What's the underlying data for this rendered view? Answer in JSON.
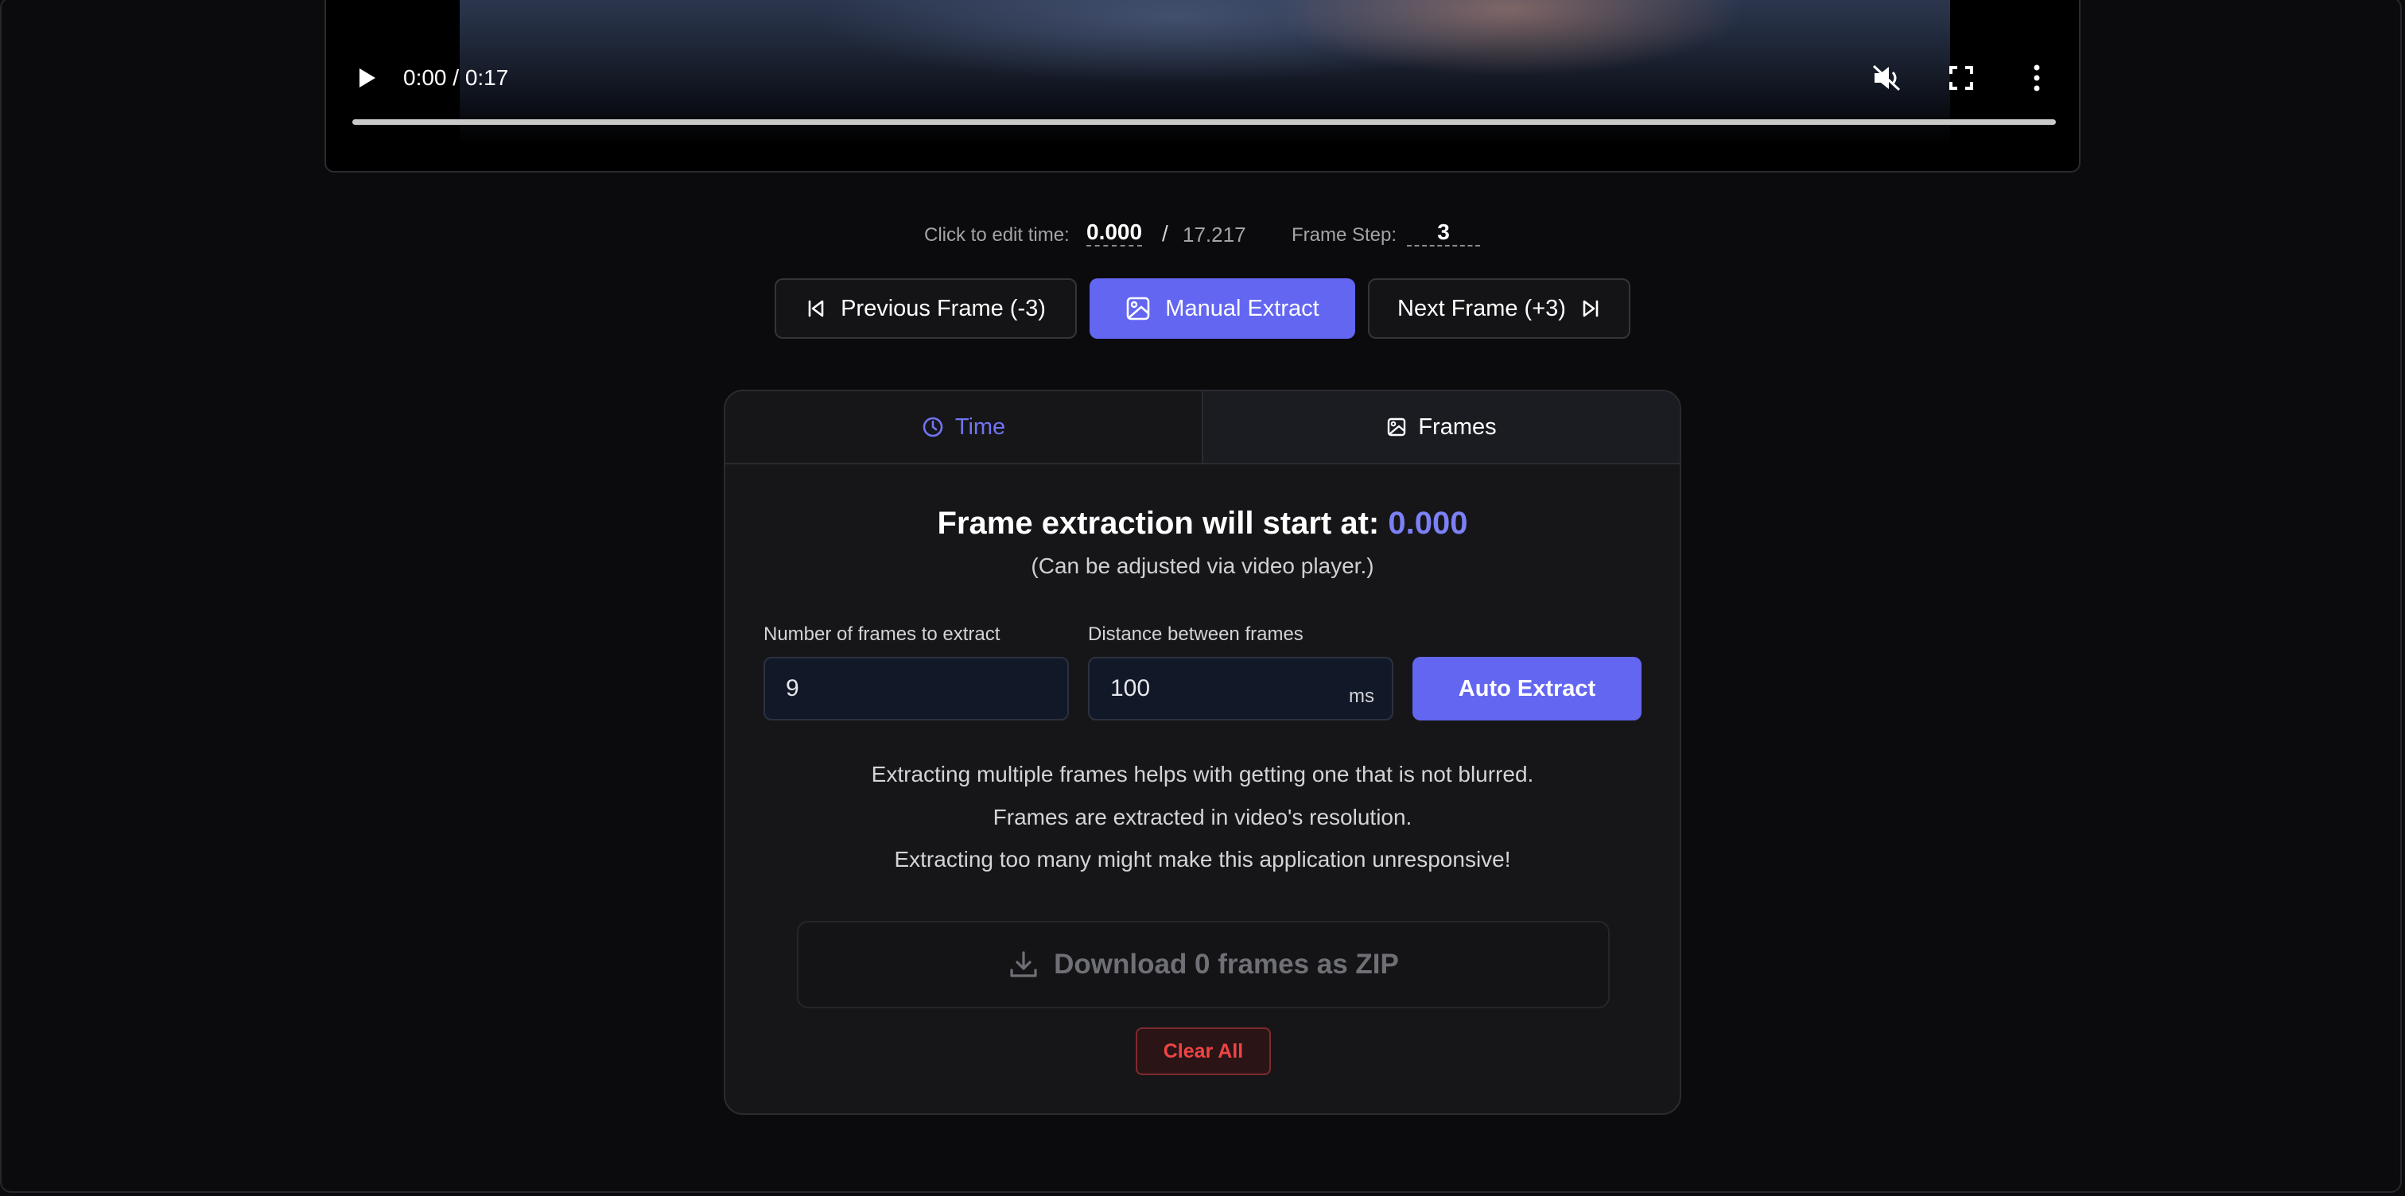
{
  "video": {
    "time_display": "0:00 / 0:17",
    "progress": 0
  },
  "time_edit": {
    "label": "Click to edit time:",
    "current": "0.000",
    "separator": "/",
    "duration": "17.217",
    "step_label": "Frame Step:",
    "step_value": "3"
  },
  "nav": {
    "prev_label": "Previous Frame (-3)",
    "manual_label": "Manual Extract",
    "next_label": "Next Frame (+3)"
  },
  "tabs": [
    {
      "label": "Time",
      "icon": "clock-icon",
      "active": true
    },
    {
      "label": "Frames",
      "icon": "image-icon",
      "active": false
    }
  ],
  "extraction": {
    "title_prefix": "Frame extraction will start at:",
    "start_value": "0.000",
    "subtitle": "(Can be adjusted via video player.)",
    "frames_label": "Number of frames to extract",
    "frames_value": "9",
    "distance_label": "Distance between frames",
    "distance_value": "100",
    "distance_unit": "ms",
    "auto_label": "Auto Extract"
  },
  "info": [
    "Extracting multiple frames helps with getting one that is not blurred.",
    "Frames are extracted in video's resolution.",
    "Extracting too many might make this application unresponsive!"
  ],
  "download": {
    "label": "Download 0 frames as ZIP"
  },
  "clear": {
    "label": "Clear All"
  },
  "colors": {
    "accent": "#6366f1",
    "danger": "#ef4444",
    "background": "#0b0b0d"
  }
}
